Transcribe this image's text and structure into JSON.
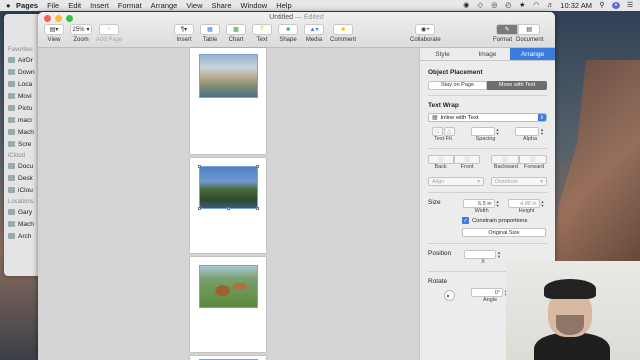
{
  "menubar": {
    "apple": "",
    "items": [
      "Pages",
      "File",
      "Edit",
      "Insert",
      "Format",
      "Arrange",
      "View",
      "Share",
      "Window",
      "Help"
    ],
    "clock": "10:32 AM"
  },
  "finder": {
    "favorites_header": "Favorites",
    "favorites": [
      "AirDr",
      "Down",
      "Loca",
      "Movi",
      "Pictu",
      "macr",
      "Mach",
      "Scre"
    ],
    "icloud_header": "iCloud",
    "icloud": [
      "Docu",
      "Desk",
      "iClou"
    ],
    "locations_header": "Locations",
    "locations": [
      "Gary",
      "Mach",
      "Arch"
    ]
  },
  "window": {
    "title": "Untitled",
    "title_status": "— Edited",
    "toolbar": {
      "view": "View",
      "zoom_value": "25%",
      "zoom": "Zoom",
      "add_page": "Add Page",
      "insert": "Insert",
      "table": "Table",
      "chart": "Chart",
      "text": "Text",
      "shape": "Shape",
      "media": "Media",
      "comment": "Comment",
      "collaborate": "Collaborate",
      "format": "Format",
      "document": "Document"
    }
  },
  "inspector": {
    "tabs": [
      "Style",
      "Image",
      "Arrange"
    ],
    "object_placement": {
      "title": "Object Placement",
      "options": [
        "Stay on Page",
        "Move with Text"
      ],
      "selected": "Move with Text"
    },
    "text_wrap": {
      "title": "Text Wrap",
      "value": "Inline with Text",
      "text_fit": "Text Fit",
      "spacing": "Spacing",
      "alpha": "Alpha"
    },
    "order": {
      "back": "Back",
      "front": "Front",
      "backward": "Backward",
      "forward": "Forward",
      "align": "Align",
      "distribute": "Distribute"
    },
    "size": {
      "title": "Size",
      "width_value": "6.5 in",
      "width_label": "Width",
      "height_value": "4.88 in",
      "height_label": "Height",
      "constrain": "Constrain proportions",
      "original_size": "Original Size"
    },
    "position": {
      "title": "Position",
      "x_label": "X"
    },
    "rotate": {
      "title": "Rotate",
      "angle_value": "0°",
      "angle_label": "Angle"
    }
  },
  "colors": {
    "accent": "#3a7ce0",
    "close": "#ff5f57",
    "minimize": "#febc2e",
    "zoom": "#28c840"
  }
}
